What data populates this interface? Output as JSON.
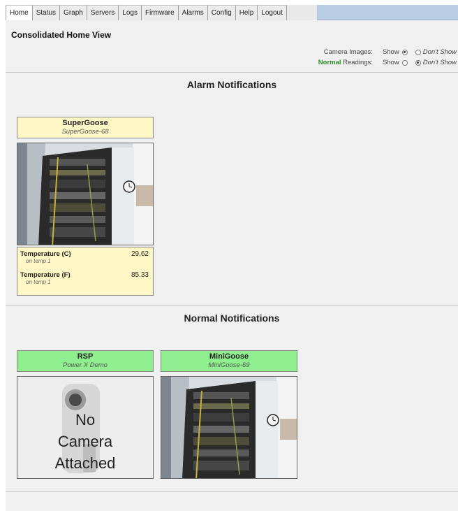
{
  "tabs": [
    "Home",
    "Status",
    "Graph",
    "Servers",
    "Logs",
    "Firmware",
    "Alarms",
    "Config",
    "Help",
    "Logout"
  ],
  "page_title": "Consolidated Home View",
  "options": {
    "camera_label": "Camera Images:",
    "normal_label_green": "Normal",
    "normal_label_rest": " Readings:",
    "show": "Show",
    "dont_show": "Don't Show",
    "camera_selected": "show",
    "normal_selected": "dont_show"
  },
  "alarm_section": {
    "title": "Alarm Notifications",
    "device": {
      "name": "SuperGoose",
      "subtitle": "SuperGoose-68",
      "readings": [
        {
          "name": "Temperature (C)",
          "sub": "on temp 1",
          "value": "29.62"
        },
        {
          "name": "Temperature (F)",
          "sub": "on temp 1",
          "value": "85.33"
        }
      ]
    }
  },
  "normal_section": {
    "title": "Normal Notifications",
    "devices": [
      {
        "name": "RSP",
        "subtitle": "Power X Demo",
        "no_camera_lines": [
          "No",
          "Camera",
          "Attached"
        ]
      },
      {
        "name": "MiniGoose",
        "subtitle": "MiniGoose-69"
      }
    ]
  },
  "colors": {
    "alarm_bg": "#fff8c6",
    "normal_bg": "#8fef8f",
    "tabbar_bg": "#b8cce4",
    "panel_bg": "#f0f0f0"
  }
}
